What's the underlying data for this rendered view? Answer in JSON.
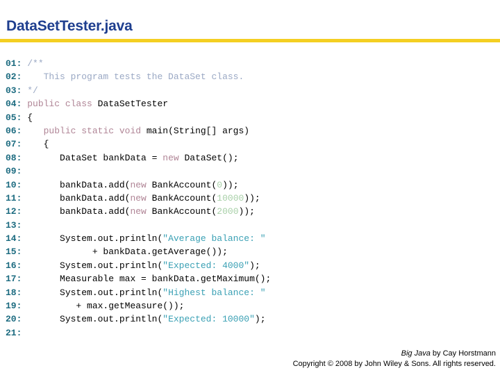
{
  "slide": {
    "title": "DataSetTester.java",
    "title_color": "#1f3f8f",
    "rule_color": "#f4cf22",
    "background": "#ffffff"
  },
  "syntax_colors": {
    "line_number": "#1c6b80",
    "plain": "#000000",
    "comment": "#9aa8c4",
    "keyword": "#b08596",
    "string": "#3aa0b4",
    "number": "#a8d0a8"
  },
  "code": {
    "language": "java",
    "lines": [
      {
        "number": "01:",
        "tokens": [
          {
            "t": "/**",
            "k": "comment"
          }
        ]
      },
      {
        "number": "02:",
        "tokens": [
          {
            "t": "   This program tests the DataSet class.",
            "k": "comment"
          }
        ]
      },
      {
        "number": "03:",
        "tokens": [
          {
            "t": "*/",
            "k": "comment"
          }
        ]
      },
      {
        "number": "04:",
        "tokens": [
          {
            "t": "public class ",
            "k": "kw"
          },
          {
            "t": "DataSetTester",
            "k": "plain"
          }
        ]
      },
      {
        "number": "05:",
        "tokens": [
          {
            "t": "{",
            "k": "plain"
          }
        ]
      },
      {
        "number": "06:",
        "tokens": [
          {
            "t": "   ",
            "k": "plain"
          },
          {
            "t": "public static void ",
            "k": "kw"
          },
          {
            "t": "main(String[] args)",
            "k": "plain"
          }
        ]
      },
      {
        "number": "07:",
        "tokens": [
          {
            "t": "   {",
            "k": "plain"
          }
        ]
      },
      {
        "number": "08:",
        "tokens": [
          {
            "t": "      DataSet bankData = ",
            "k": "plain"
          },
          {
            "t": "new ",
            "k": "kw"
          },
          {
            "t": "DataSet();",
            "k": "plain"
          }
        ]
      },
      {
        "number": "09:",
        "tokens": []
      },
      {
        "number": "10:",
        "tokens": [
          {
            "t": "      bankData.add(",
            "k": "plain"
          },
          {
            "t": "new ",
            "k": "kw"
          },
          {
            "t": "BankAccount(",
            "k": "plain"
          },
          {
            "t": "0",
            "k": "num"
          },
          {
            "t": "));",
            "k": "plain"
          }
        ]
      },
      {
        "number": "11:",
        "tokens": [
          {
            "t": "      bankData.add(",
            "k": "plain"
          },
          {
            "t": "new ",
            "k": "kw"
          },
          {
            "t": "BankAccount(",
            "k": "plain"
          },
          {
            "t": "10000",
            "k": "num"
          },
          {
            "t": "));",
            "k": "plain"
          }
        ]
      },
      {
        "number": "12:",
        "tokens": [
          {
            "t": "      bankData.add(",
            "k": "plain"
          },
          {
            "t": "new ",
            "k": "kw"
          },
          {
            "t": "BankAccount(",
            "k": "plain"
          },
          {
            "t": "2000",
            "k": "num"
          },
          {
            "t": "));",
            "k": "plain"
          }
        ]
      },
      {
        "number": "13:",
        "tokens": []
      },
      {
        "number": "14:",
        "tokens": [
          {
            "t": "      System.out.println(",
            "k": "plain"
          },
          {
            "t": "\"Average balance: \"",
            "k": "str"
          }
        ]
      },
      {
        "number": "15:",
        "tokens": [
          {
            "t": "            + bankData.getAverage());",
            "k": "plain"
          }
        ]
      },
      {
        "number": "16:",
        "tokens": [
          {
            "t": "      System.out.println(",
            "k": "plain"
          },
          {
            "t": "\"Expected: 4000\"",
            "k": "str"
          },
          {
            "t": ");",
            "k": "plain"
          }
        ]
      },
      {
        "number": "17:",
        "tokens": [
          {
            "t": "      Measurable max = bankData.getMaximum();",
            "k": "plain"
          }
        ]
      },
      {
        "number": "18:",
        "tokens": [
          {
            "t": "      System.out.println(",
            "k": "plain"
          },
          {
            "t": "\"Highest balance: \"",
            "k": "str"
          }
        ]
      },
      {
        "number": "19:",
        "tokens": [
          {
            "t": "         + max.getMeasure());",
            "k": "plain"
          }
        ]
      },
      {
        "number": "20:",
        "tokens": [
          {
            "t": "      System.out.println(",
            "k": "plain"
          },
          {
            "t": "\"Expected: 10000\"",
            "k": "str"
          },
          {
            "t": ");",
            "k": "plain"
          }
        ]
      },
      {
        "number": "21:",
        "tokens": []
      }
    ]
  },
  "footer": {
    "book_title": "Big Java",
    "byline": " by Cay Horstmann",
    "copyright": "Copyright © 2008 by John Wiley & Sons.  All rights reserved."
  }
}
